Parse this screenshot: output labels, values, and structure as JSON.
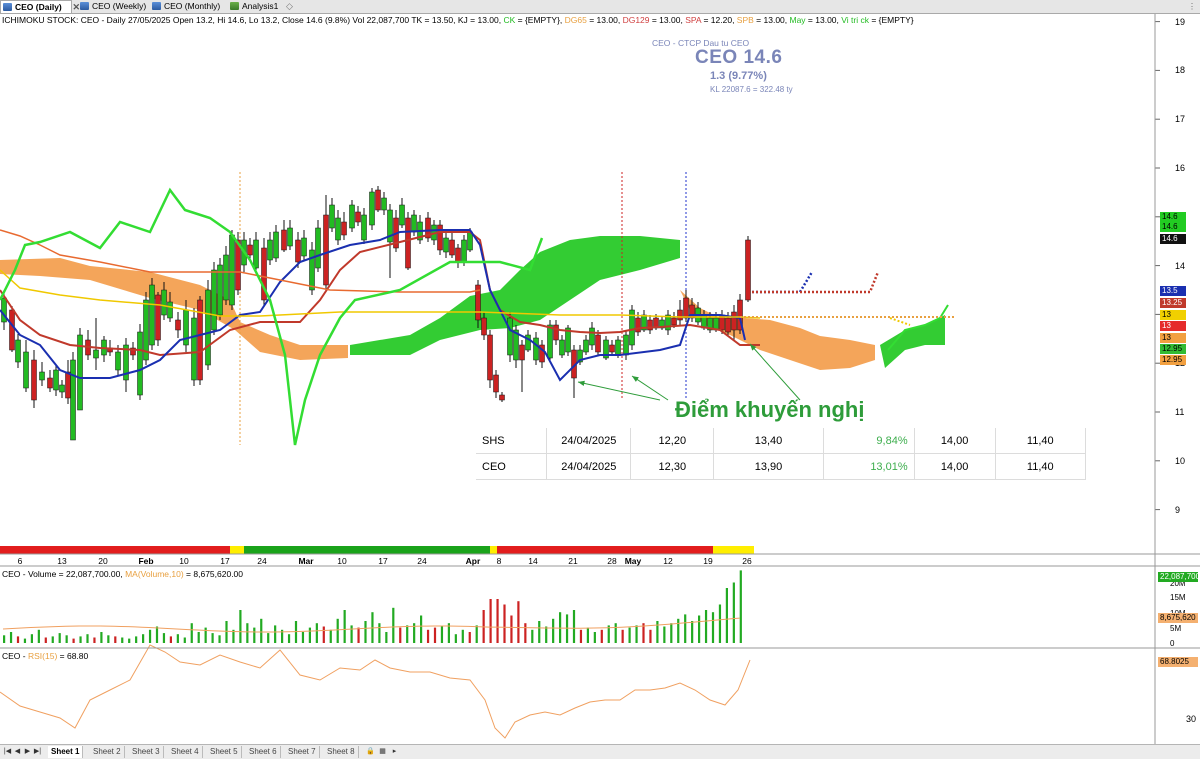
{
  "tabs": [
    {
      "label": "CEO (Daily)",
      "active": true
    },
    {
      "label": "CEO (Weekly)",
      "active": false
    },
    {
      "label": "CEO (Monthly)",
      "active": false
    },
    {
      "label": "Analysis1",
      "active": false
    }
  ],
  "infobar": [
    {
      "text": "ICHIMOKU STOCK: CEO - Daily 27/05/2025 Open 13.2, Hi 14.6, Lo 13.2, Close 14.6 (9.8%) Vol 22,087,700 TK = 13.50, KJ = 13.00, ",
      "color": "#000000"
    },
    {
      "text": "CK",
      "color": "#22bb22"
    },
    {
      "text": " = {EMPTY}, ",
      "color": "#000000"
    },
    {
      "text": "DG65",
      "color": "#e8a040"
    },
    {
      "text": " = 13.00, ",
      "color": "#000000"
    },
    {
      "text": "DG129",
      "color": "#d04040"
    },
    {
      "text": " = 13.00, ",
      "color": "#000000"
    },
    {
      "text": "SPA",
      "color": "#d04040"
    },
    {
      "text": " = 12.20, ",
      "color": "#000000"
    },
    {
      "text": "SPB",
      "color": "#e8a040"
    },
    {
      "text": " = 13.00, ",
      "color": "#000000"
    },
    {
      "text": "May",
      "color": "#22bb22"
    },
    {
      "text": " = 13.00, ",
      "color": "#000000"
    },
    {
      "text": "Vi tri ck",
      "color": "#22bb22"
    },
    {
      "text": " = {EMPTY}",
      "color": "#000000"
    }
  ],
  "symbol_box": {
    "title": "CEO - CTCP Dau tu CEO",
    "price": "CEO  14.6",
    "change": "1.3 (9.77%)",
    "kl": "KL 22087.6 = 322.48 ty"
  },
  "price_axis": [
    "19",
    "18",
    "17",
    "16",
    "15",
    "14",
    "13",
    "12",
    "11",
    "10",
    "9"
  ],
  "price_tags": [
    {
      "text": "14.6",
      "bg": "#22cc22",
      "fg": "#000000"
    },
    {
      "text": "14.6",
      "bg": "#22cc22",
      "fg": "#000000"
    },
    {
      "text": "14.6",
      "bg": "#111111",
      "fg": "#ffffff"
    },
    {
      "text": "13.5",
      "bg": "#1a2fb0",
      "fg": "#ffffff"
    },
    {
      "text": "13.25",
      "bg": "#c0392b",
      "fg": "#ffffff"
    },
    {
      "text": "13",
      "bg": "#f1d000",
      "fg": "#000000"
    },
    {
      "text": "13",
      "bg": "#e52b2b",
      "fg": "#ffffff"
    },
    {
      "text": "13",
      "bg": "#f2a040",
      "fg": "#000000"
    },
    {
      "text": "12.95",
      "bg": "#33bb33",
      "fg": "#000000"
    },
    {
      "text": "12.95",
      "bg": "#f2a040",
      "fg": "#000000"
    }
  ],
  "date_axis": [
    "6",
    "13",
    "20",
    "Feb",
    "10",
    "17",
    "24",
    "Mar",
    "10",
    "17",
    "24",
    "Apr",
    "8",
    "14",
    "21",
    "28",
    "May",
    "12",
    "19",
    "26"
  ],
  "callout": "Điểm khuyến nghị",
  "recommendations": [
    {
      "code": "SHS",
      "date": "24/04/2025",
      "buy": "12,20",
      "target": "13,40",
      "pct": "9,84%",
      "v1": "14,00",
      "v2": "11,40"
    },
    {
      "code": "CEO",
      "date": "24/04/2025",
      "buy": "12,30",
      "target": "13,90",
      "pct": "13,01%",
      "v1": "14,00",
      "v2": "11,40"
    }
  ],
  "volume_panel": {
    "label_prefix": "CEO - Volume = 22,087,700.00, ",
    "ma_label": "MA(Volume,10)",
    "ma_value": " = 8,675,620.00",
    "axis": [
      "20M",
      "15M",
      "10M",
      "5M",
      "0"
    ],
    "tag_volume": "22,087,700",
    "tag_ma": "8,675,620"
  },
  "rsi_panel": {
    "label_prefix": "CEO - ",
    "rsi_label": "RSI(15)",
    "rsi_value": " = 68.80",
    "axis": [
      "30"
    ],
    "tag": "68.8025"
  },
  "sheets": [
    "Sheet 1",
    "Sheet 2",
    "Sheet 3",
    "Sheet 4",
    "Sheet 5",
    "Sheet 6",
    "Sheet 7",
    "Sheet 8"
  ],
  "colors": {
    "up": "#22bb22",
    "down": "#cc2222",
    "tenkan": "#1a2fb0",
    "kijun": "#c0392b",
    "chikou": "#33dd33",
    "cloud_bull": "#33cc33",
    "cloud_bear": "#f4a55a"
  }
}
